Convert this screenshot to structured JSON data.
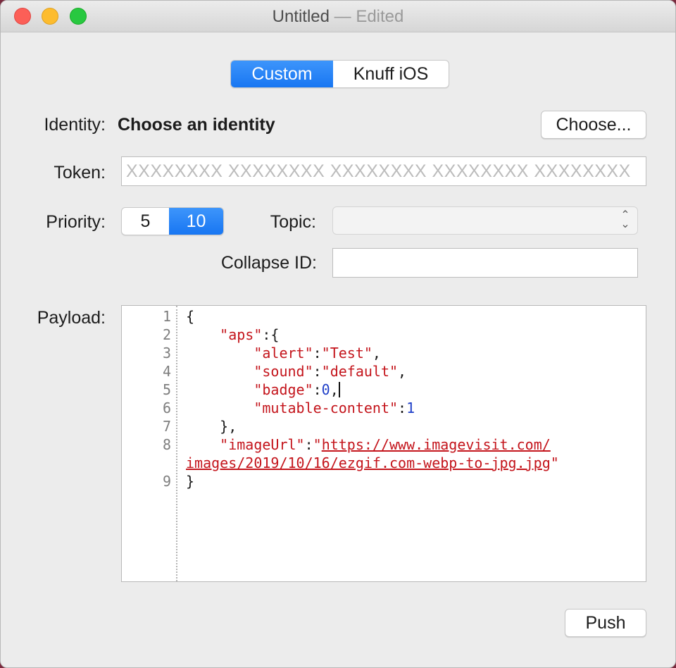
{
  "window": {
    "title": "Untitled",
    "title_suffix": " — Edited"
  },
  "mode_tabs": [
    {
      "label": "Custom",
      "selected": true
    },
    {
      "label": "Knuff iOS",
      "selected": false
    }
  ],
  "identity": {
    "label": "Identity:",
    "value": "Choose an identity",
    "button": "Choose..."
  },
  "token": {
    "label": "Token:",
    "placeholder": "XXXXXXXX XXXXXXXX XXXXXXXX XXXXXXXX XXXXXXXX",
    "value": ""
  },
  "priority": {
    "label": "Priority:",
    "options": [
      {
        "label": "5",
        "selected": false
      },
      {
        "label": "10",
        "selected": true
      }
    ]
  },
  "topic": {
    "label": "Topic:",
    "value": ""
  },
  "collapse_id": {
    "label": "Collapse ID:",
    "value": ""
  },
  "payload": {
    "label": "Payload:",
    "line_numbers": [
      "1",
      "2",
      "3",
      "4",
      "5",
      "6",
      "7",
      "8",
      "",
      "9"
    ],
    "lines": [
      [
        {
          "t": "p",
          "v": "{"
        }
      ],
      [
        {
          "t": "p",
          "v": "    "
        },
        {
          "t": "k",
          "v": "\"aps\""
        },
        {
          "t": "p",
          "v": ":{"
        }
      ],
      [
        {
          "t": "p",
          "v": "        "
        },
        {
          "t": "k",
          "v": "\"alert\""
        },
        {
          "t": "p",
          "v": ":"
        },
        {
          "t": "s",
          "v": "\"Test\""
        },
        {
          "t": "p",
          "v": ","
        }
      ],
      [
        {
          "t": "p",
          "v": "        "
        },
        {
          "t": "k",
          "v": "\"sound\""
        },
        {
          "t": "p",
          "v": ":"
        },
        {
          "t": "s",
          "v": "\"default\""
        },
        {
          "t": "p",
          "v": ","
        }
      ],
      [
        {
          "t": "p",
          "v": "        "
        },
        {
          "t": "k",
          "v": "\"badge\""
        },
        {
          "t": "p",
          "v": ":"
        },
        {
          "t": "n",
          "v": "0"
        },
        {
          "t": "p",
          "v": ","
        },
        {
          "t": "caret",
          "v": ""
        }
      ],
      [
        {
          "t": "p",
          "v": "        "
        },
        {
          "t": "k",
          "v": "\"mutable-content\""
        },
        {
          "t": "p",
          "v": ":"
        },
        {
          "t": "n",
          "v": "1"
        }
      ],
      [
        {
          "t": "p",
          "v": "    },"
        }
      ],
      [
        {
          "t": "p",
          "v": "    "
        },
        {
          "t": "k",
          "v": "\"imageUrl\""
        },
        {
          "t": "p",
          "v": ":"
        },
        {
          "t": "s",
          "v": "\""
        },
        {
          "t": "u",
          "v": "https://www.imagevisit.com/"
        }
      ],
      [
        {
          "t": "u",
          "v": "images/2019/10/16/ezgif.com-webp-to-jpg.jpg"
        },
        {
          "t": "s",
          "v": "\""
        }
      ],
      [
        {
          "t": "p",
          "v": "}"
        }
      ]
    ]
  },
  "push_button": "Push",
  "colors": {
    "accent": "#1876f2",
    "json_key": "#c4151c",
    "json_number": "#1f3fc8"
  }
}
